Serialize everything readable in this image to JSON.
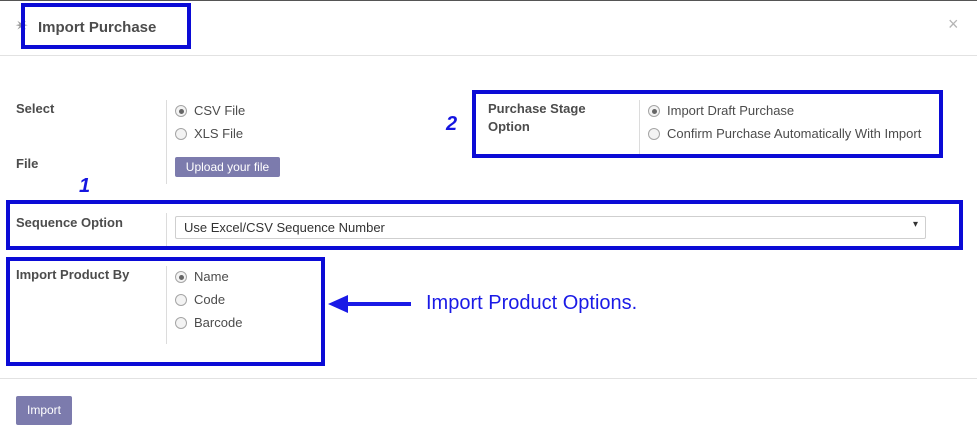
{
  "dialog": {
    "title": "Import Purchase",
    "close_symbol": "×",
    "title_icon": "gear-icon"
  },
  "select_section": {
    "label": "Select",
    "options": [
      {
        "label": "CSV File",
        "checked": true
      },
      {
        "label": "XLS File",
        "checked": false
      }
    ]
  },
  "file_section": {
    "label": "File",
    "upload_label": "Upload your file"
  },
  "purchase_stage": {
    "label_line1": "Purchase Stage",
    "label_line2": "Option",
    "options": [
      {
        "label": "Import Draft Purchase",
        "checked": true
      },
      {
        "label": "Confirm Purchase Automatically With Import",
        "checked": false
      }
    ]
  },
  "sequence_section": {
    "label": "Sequence Option",
    "selected": "Use Excel/CSV Sequence Number",
    "caret": "▾"
  },
  "import_product": {
    "label": "Import Product By",
    "options": [
      {
        "label": "Name",
        "checked": true
      },
      {
        "label": "Code",
        "checked": false
      },
      {
        "label": "Barcode",
        "checked": false
      }
    ]
  },
  "annotations": {
    "marker_1": "1",
    "marker_2": "2",
    "product_options_note": "Import Product Options.",
    "highlight_color": "#0b0bd6"
  },
  "footer": {
    "import_label": "Import"
  }
}
